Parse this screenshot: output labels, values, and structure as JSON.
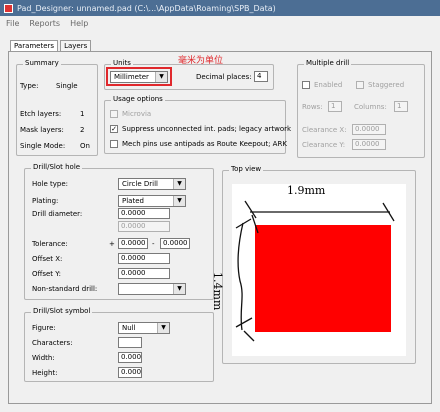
{
  "window": {
    "title": "Pad_Designer: unnamed.pad (C:\\...\\AppData\\Roaming\\SPB_Data)"
  },
  "menu": [
    "File",
    "Reports",
    "Help"
  ],
  "tabs": [
    "Parameters",
    "Layers"
  ],
  "summary": {
    "label": "Summary",
    "type_label": "Type:",
    "type_value": "Single",
    "etch_label": "Etch layers:",
    "etch_value": "1",
    "mask_label": "Mask layers:",
    "mask_value": "2",
    "single_label": "Single Mode:",
    "single_value": "On"
  },
  "units": {
    "label": "Units",
    "value": "Millimeter",
    "decimal_label": "Decimal places:",
    "decimal_value": "4",
    "annotation": "毫米为单位",
    "annotation_color": "#e0282c"
  },
  "usage": {
    "label": "Usage options",
    "microvia": "Microvia",
    "suppress": "Suppress unconnected int. pads; legacy artwork",
    "mech": "Mech pins use antipads as Route Keepout; ARK"
  },
  "multiple_drill": {
    "label": "Multiple drill",
    "enabled": "Enabled",
    "staggered": "Staggered",
    "rows_label": "Rows:",
    "rows_value": "1",
    "columns_label": "Columns:",
    "columns_value": "1",
    "clearance_x_label": "Clearance X:",
    "clearance_x_value": "0.0000",
    "clearance_y_label": "Clearance Y:",
    "clearance_y_value": "0.0000"
  },
  "drill": {
    "label": "Drill/Slot hole",
    "hole_type_label": "Hole type:",
    "hole_type_value": "Circle Drill",
    "plating_label": "Plating:",
    "plating_value": "Plated",
    "diameter_label": "Drill diameter:",
    "diameter_value": "0.0000",
    "diameter_value2": "0.0000",
    "tolerance_label": "Tolerance:",
    "tolerance_plus": "+",
    "tolerance_pos": "0.0000",
    "tolerance_minus": "-",
    "tolerance_neg": "0.0000",
    "offset_x_label": "Offset X:",
    "offset_x_value": "0.0000",
    "offset_y_label": "Offset Y:",
    "offset_y_value": "0.0000",
    "nonstd_label": "Non-standard drill:",
    "nonstd_value": ""
  },
  "drill_symbol": {
    "label": "Drill/Slot symbol",
    "figure_label": "Figure:",
    "figure_value": "Null",
    "characters_label": "Characters:",
    "characters_value": "",
    "width_label": "Width:",
    "width_value": "0.0000",
    "height_label": "Height:",
    "height_value": "0.0000"
  },
  "top_view": {
    "label": "Top view",
    "pad_color": "#ff0000",
    "width_annotation": "1.9mm",
    "height_annotation": "1.4mm"
  }
}
